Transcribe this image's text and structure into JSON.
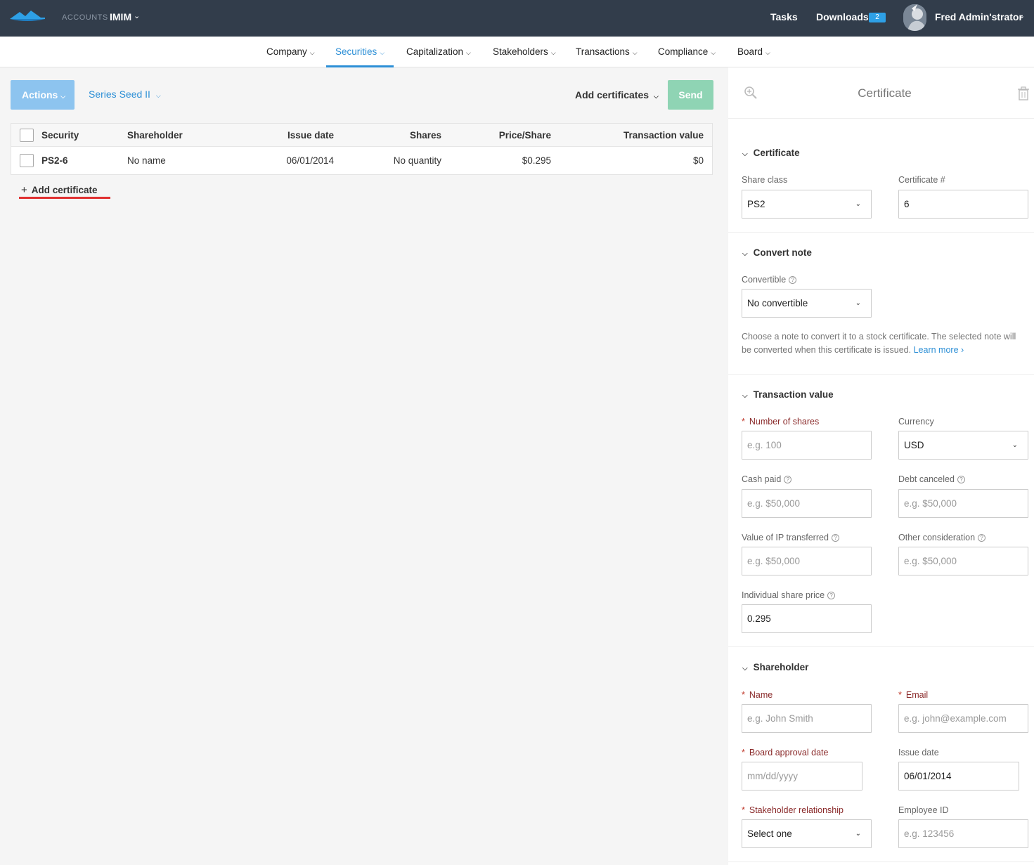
{
  "topbar": {
    "accounts_label": "ACCOUNTS",
    "account_name": "IMIM",
    "tasks": "Tasks",
    "downloads": "Downloads",
    "downloads_count": "2",
    "user_name": "Fred Admin'strator"
  },
  "nav": {
    "items": [
      "Company",
      "Securities",
      "Capitalization",
      "Stakeholders",
      "Transactions",
      "Compliance",
      "Board"
    ],
    "active": "Securities"
  },
  "toolbar": {
    "actions_label": "Actions",
    "series_label": "Series Seed II",
    "add_certificates_label": "Add certificates",
    "send_label": "Send"
  },
  "table": {
    "headers": [
      "Security",
      "Shareholder",
      "Issue date",
      "Shares",
      "Price/Share",
      "Transaction value"
    ],
    "rows": [
      [
        "PS2-6",
        "No name",
        "06/01/2014",
        "No quantity",
        "$0.295",
        "$0"
      ]
    ]
  },
  "add_certificate_label": "Add certificate",
  "panel": {
    "title": "Certificate",
    "certificate": {
      "section_title": "Certificate",
      "share_class_label": "Share class",
      "share_class_value": "PS2",
      "cert_no_label": "Certificate #",
      "cert_no_value": "6"
    },
    "convert": {
      "section_title": "Convert note",
      "convertible_label": "Convertible",
      "convertible_value": "No convertible",
      "help_text": "Choose a note to convert it to a stock certificate. The selected note will be converted when this certificate is issued.",
      "learn_more": "Learn more ›"
    },
    "transaction": {
      "section_title": "Transaction value",
      "num_shares_label": "Number of shares",
      "num_shares_placeholder": "e.g. 100",
      "currency_label": "Currency",
      "currency_value": "USD",
      "cash_paid_label": "Cash paid",
      "cash_paid_placeholder": "e.g. $50,000",
      "debt_canceled_label": "Debt canceled",
      "debt_canceled_placeholder": "e.g. $50,000",
      "ip_label": "Value of IP transferred",
      "ip_placeholder": "e.g. $50,000",
      "other_label": "Other consideration",
      "other_placeholder": "e.g. $50,000",
      "share_price_label": "Individual share price",
      "share_price_value": "0.295"
    },
    "shareholder": {
      "section_title": "Shareholder",
      "name_label": "Name",
      "name_placeholder": "e.g. John Smith",
      "email_label": "Email",
      "email_placeholder": "e.g. john@example.com",
      "board_date_label": "Board approval date",
      "board_date_placeholder": "mm/dd/yyyy",
      "issue_date_label": "Issue date",
      "issue_date_value": "06/01/2014",
      "relationship_label": "Stakeholder relationship",
      "relationship_value": "Select one",
      "employee_id_label": "Employee ID",
      "employee_id_placeholder": "e.g. 123456"
    }
  },
  "colors": {
    "topbar": "#323d4b",
    "accent": "#2c8fd6",
    "send": "#8fd4b4",
    "actions": "#8dc4ef",
    "required": "#c0392b"
  }
}
